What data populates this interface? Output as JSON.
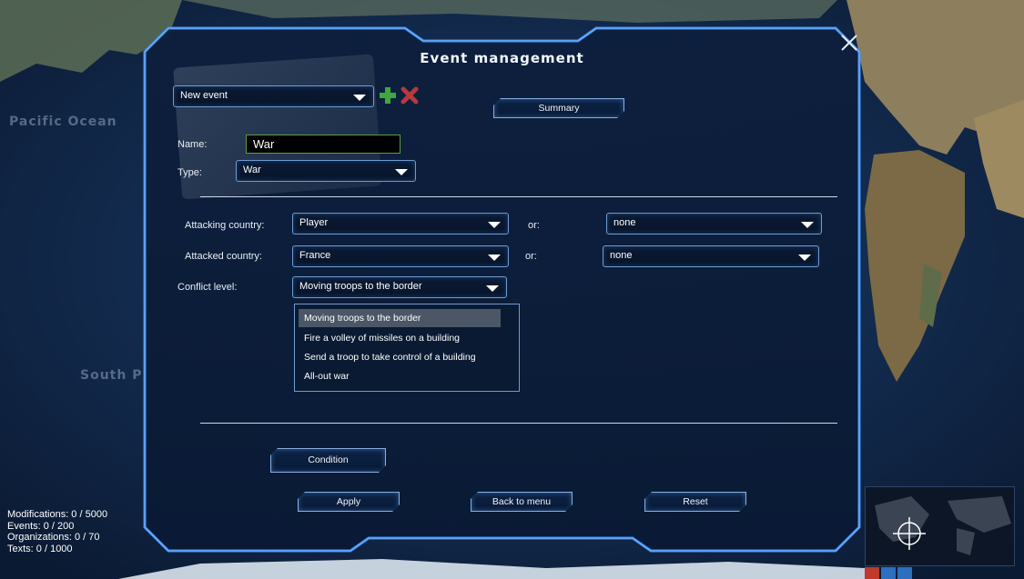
{
  "map": {
    "labels": {
      "pacific": "Pacific Ocean",
      "south": "South P"
    }
  },
  "dialog": {
    "title": "Event management",
    "event_select": "New event",
    "summary_label": "Summary",
    "name_label": "Name:",
    "name_value": "War",
    "type_label": "Type:",
    "type_value": "War",
    "attacking_label": "Attacking country:",
    "attacking_value": "Player",
    "attacking_or_label": "or:",
    "attacking_or_value": "none",
    "attacked_label": "Attacked country:",
    "attacked_value": "France",
    "attacked_or_label": "or:",
    "attacked_or_value": "none",
    "conflict_label": "Conflict level:",
    "conflict_value": "Moving troops to the border",
    "conflict_options": [
      "Moving troops to the border",
      "Fire a volley of missiles on a building",
      "Send a troop to take control of a building",
      "All-out war"
    ],
    "condition_label": "Condition",
    "apply_label": "Apply",
    "back_label": "Back to menu",
    "reset_label": "Reset"
  },
  "stats": {
    "modifications": "Modifications: 0 /  5000",
    "events": "Events: 0 /  200",
    "organizations": "Organizations: 0 /  70",
    "texts": "Texts: 0 /  1000"
  },
  "colors": {
    "accent": "#3f8ff0",
    "add": "#3ea83e",
    "delete": "#b53a3a"
  }
}
